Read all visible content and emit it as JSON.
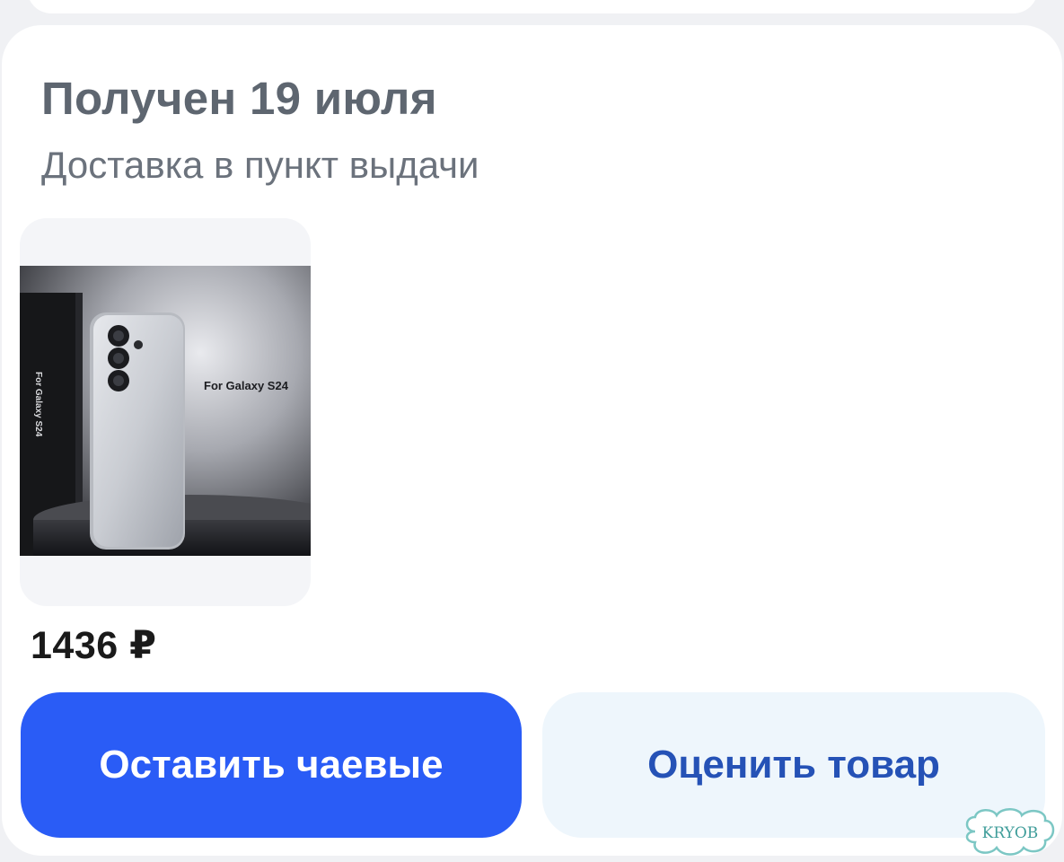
{
  "order": {
    "status_title": "Получен 19 июля",
    "delivery_method": "Доставка в пункт выдачи",
    "product": {
      "image_caption": "For Galaxy S24",
      "box_label": "For Galaxy S24",
      "price": "1436 ₽"
    },
    "buttons": {
      "tip_label": "Оставить чаевые",
      "rate_label": "Оценить товар"
    }
  },
  "watermark": {
    "text": "KRYOB"
  },
  "colors": {
    "primary_button": "#2a5cf6",
    "secondary_button_bg": "#eef6fc",
    "secondary_button_text": "#2552b6",
    "title_text": "#5e6670"
  }
}
